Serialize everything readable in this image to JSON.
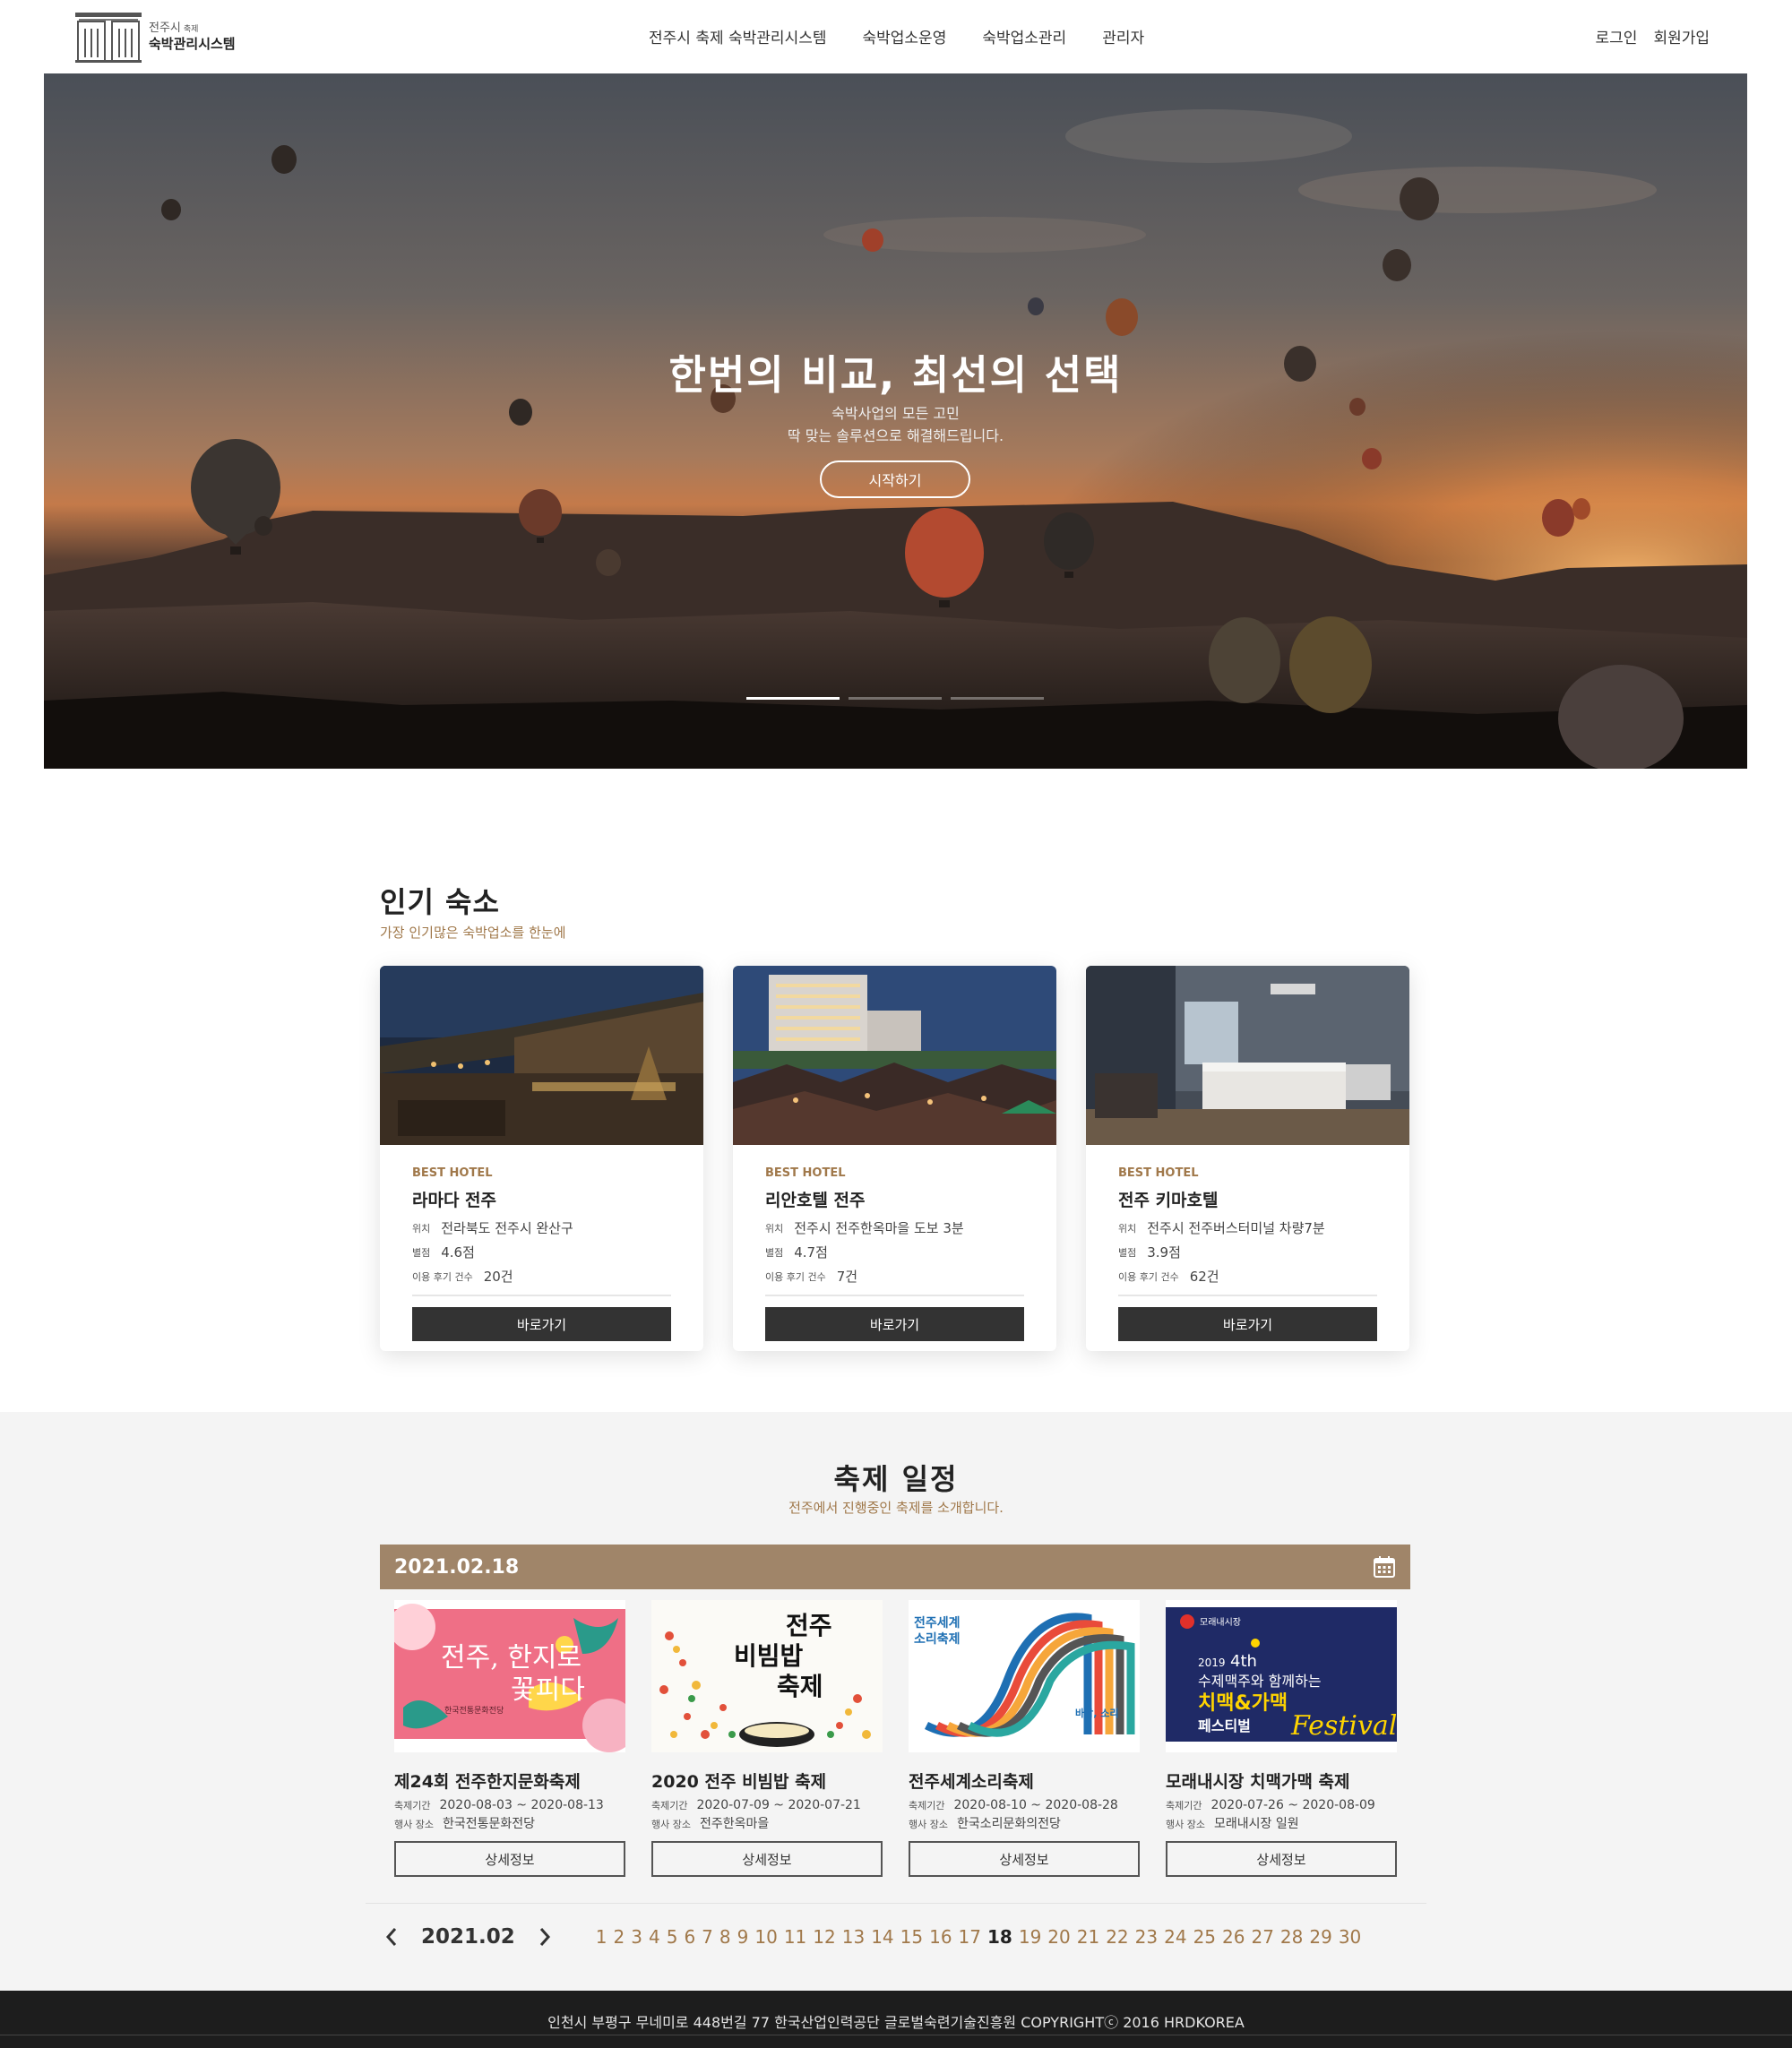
{
  "brand": {
    "small": "전주시",
    "small2": "축제",
    "name": "숙박관리시스템"
  },
  "nav": [
    {
      "label": "전주시 축제 숙박관리시스템"
    },
    {
      "label": "숙박업소운영"
    },
    {
      "label": "숙박업소관리"
    },
    {
      "label": "관리자"
    }
  ],
  "util": {
    "login": "로그인",
    "signup": "회원가입"
  },
  "hero": {
    "title": "한번의 비교, 최선의 선택",
    "sub1": "숙박사업의 모든 고민",
    "sub2": "딱 맞는 솔루션으로 해결해드립니다.",
    "button": "시작하기",
    "slides": 3,
    "active_slide": 1
  },
  "popular": {
    "title": "인기 숙소",
    "subtitle": "가장 인기많은 숙박업소를 한눈에",
    "labels": {
      "location": "위치",
      "rating": "별점",
      "reviews": "이용 후기 건수"
    },
    "cards": [
      {
        "tag": "BEST HOTEL",
        "name": "라마다 전주",
        "location": "전라북도 전주시 완산구",
        "rating": "4.6점",
        "reviews": "20건",
        "button": "바로가기"
      },
      {
        "tag": "BEST HOTEL",
        "name": "리안호텔 전주",
        "location": "전주시 전주한옥마을 도보 3분",
        "rating": "4.7점",
        "reviews": "7건",
        "button": "바로가기"
      },
      {
        "tag": "BEST HOTEL",
        "name": "전주 키마호텔",
        "location": "전주시 전주버스터미널 차량7분",
        "rating": "3.9점",
        "reviews": "62건",
        "button": "바로가기"
      }
    ]
  },
  "festival": {
    "title": "축제 일정",
    "subtitle": "전주에서 진행중인 축제를 소개합니다.",
    "date": "2021.02.18",
    "labels": {
      "period": "축제기간",
      "place": "행사 장소"
    },
    "items": [
      {
        "name": "제24회 전주한지문화축제",
        "period": "2020-08-03 ~ 2020-08-13",
        "place": "한국전통문화전당",
        "button": "상세정보",
        "poster": {
          "line1": "전주, 한지로",
          "line2": "꽃피다",
          "small": "한국전통문화전당"
        }
      },
      {
        "name": "2020 전주 비빔밥 축제",
        "period": "2020-07-09 ~ 2020-07-21",
        "place": "전주한옥마을",
        "button": "상세정보",
        "poster": {
          "line1": "전주",
          "line2": "비빔밥",
          "line3": "축제"
        }
      },
      {
        "name": "전주세계소리축제",
        "period": "2020-08-10 ~ 2020-08-28",
        "place": "한국소리문화의전당",
        "button": "상세정보",
        "poster": {
          "line1": "전주세계",
          "line2": "소리축제",
          "side": "바람, 소리"
        }
      },
      {
        "name": "모래내시장 치맥가맥 축제",
        "period": "2020-07-26 ~ 2020-08-09",
        "place": "모래내시장 일원",
        "button": "상세정보",
        "poster": {
          "year": "2019",
          "edition": "4th",
          "line1": "수제맥주와 함께하는",
          "line2": "치맥&가맥",
          "line3": "페스티벌",
          "script": "Festival",
          "top": "모래내시장"
        }
      }
    ],
    "pager": {
      "month": "2021.02",
      "days": [
        "1",
        "2",
        "3",
        "4",
        "5",
        "6",
        "7",
        "8",
        "9",
        "10",
        "11",
        "12",
        "13",
        "14",
        "15",
        "16",
        "17",
        "18",
        "19",
        "20",
        "21",
        "22",
        "23",
        "24",
        "25",
        "26",
        "27",
        "28",
        "29",
        "30"
      ],
      "current": "18"
    }
  },
  "footer": {
    "text": "인천시 부평구 무네미로 448번길 77 한국산업인력공단 글로벌숙련기술진흥원 COPYRIGHTⓒ 2016 HRDKOREA"
  },
  "colors": {
    "accent": "#a0784a",
    "datebar": "#a08569",
    "dark": "#333333",
    "footer": "#1d1d1d"
  },
  "icons": {
    "calendar": "calendar-icon",
    "prev": "chevron-left-icon",
    "next": "chevron-right-icon",
    "logo": "building-logo-icon"
  }
}
